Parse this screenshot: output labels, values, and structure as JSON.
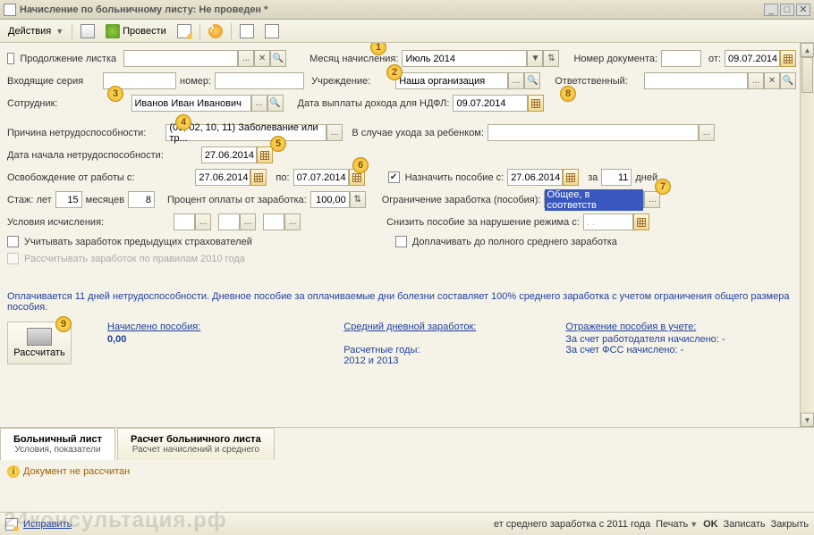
{
  "window": {
    "title": "Начисление по больничному листу: Не проведен *"
  },
  "toolbar": {
    "actions": "Действия",
    "provesti": "Провести"
  },
  "fields": {
    "continuation": "Продолжение листка",
    "month_label": "Месяц начисления:",
    "month_value": "Июль 2014",
    "docnum_label": "Номер документа:",
    "ot_label": "от:",
    "ot_value": "09.07.2014",
    "inseries_label": "Входящие серия",
    "inseries_num": "номер:",
    "org_label": "Учреждение:",
    "org_value": "Наша организация",
    "resp_label": "Ответственный:",
    "employee_label": "Сотрудник:",
    "employee_value": "Иванов Иван Иванович",
    "payday_label": "Дата выплаты дохода для НДФЛ:",
    "payday_value": "09.07.2014",
    "reason_label": "Причина нетрудоспособности:",
    "reason_value": "(01, 02, 10, 11) Заболевание или тр...",
    "childcare_label": "В случае ухода за ребенком:",
    "startdate_label": "Дата начала нетрудоспособности:",
    "startdate_value": "27.06.2014",
    "release_label": "Освобождение от работы с:",
    "release_from": "27.06.2014",
    "release_to_label": "по:",
    "release_to": "07.07.2014",
    "assign_label": "Назначить пособие с:",
    "assign_value": "27.06.2014",
    "assign_za": "за",
    "assign_days": "11",
    "assign_days_lbl": "дней",
    "stazh_label": "Стаж: лет",
    "stazh_years": "15",
    "stazh_months_lbl": "месяцев",
    "stazh_months": "8",
    "percent_label": "Процент оплаты от заработка:",
    "percent_value": "100,00",
    "limit_label": "Ограничение заработка (пособия):",
    "limit_value": "Общее, в соответств",
    "calc_cond_label": "Условия исчисления:",
    "violation_label": "Снизить пособие за нарушение режима с:",
    "violation_value": ". .",
    "prev_insurers": "Учитывать заработок предыдущих страхователей",
    "pay_full": "Доплачивать до полного среднего заработка",
    "rules2010": "Рассчитывать заработок по правилам 2010 года"
  },
  "info": "Оплачивается 11 дней нетрудоспособности. Дневное пособие за оплачиваемые дни болезни составляет 100% среднего заработка с учетом ограничения общего размера пособия.",
  "summary": {
    "calc_btn": "Рассчитать",
    "accrued_label": "Начислено пособия:",
    "accrued_value": "0,00",
    "avg_label": "Средний дневной заработок:",
    "years_label": "Расчетные годы:",
    "years_value": "2012 и 2013",
    "reflect_label": "Отражение пособия в учете:",
    "employer": "За счет работодателя начислено: -",
    "fss": "За счет ФСС начислено: -"
  },
  "tabs": {
    "t1_title": "Больничный лист",
    "t1_sub": "Условия, показатели",
    "t2_title": "Расчет больничного листа",
    "t2_sub": "Расчет начислений и среднего"
  },
  "warning": "Документ не рассчитан",
  "status": {
    "fix": "Исправить",
    "mid": "ет среднего заработка с 2011 года",
    "print": "Печать",
    "ok": "OK",
    "save": "Записать",
    "close": "Закрыть"
  },
  "watermark": "24консультация.рф",
  "badges": {
    "b1": "1",
    "b2": "2",
    "b3": "3",
    "b4": "4",
    "b5": "5",
    "b6": "6",
    "b7": "7",
    "b8": "8",
    "b9": "9"
  }
}
